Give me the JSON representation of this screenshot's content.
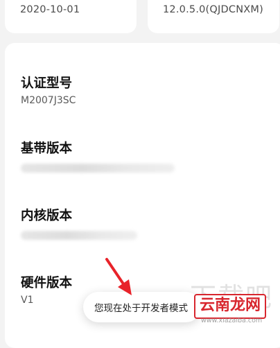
{
  "top_cards": {
    "left_value": "2020-10-01",
    "right_value": "12.0.5.0(QJDCNXM)"
  },
  "info": {
    "model": {
      "label": "认证型号",
      "value": "M2007J3SC"
    },
    "baseband": {
      "label": "基带版本"
    },
    "kernel": {
      "label": "内核版本"
    },
    "hardware": {
      "label": "硬件版本",
      "value": "V1"
    }
  },
  "toast": {
    "text": "您现在处于开发者模式"
  },
  "annotation": {
    "arrow_color": "#e8232a"
  },
  "watermark": {
    "ghost_text": "下载吧",
    "badge_text": "云南龙网",
    "url": "www.xiazaiba.com"
  }
}
